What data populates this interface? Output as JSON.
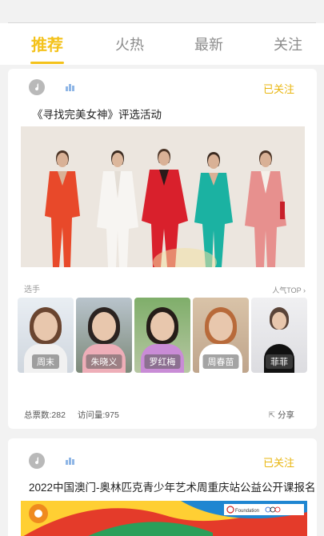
{
  "tabs": [
    {
      "label": "推荐",
      "active": true
    },
    {
      "label": "火热",
      "active": false
    },
    {
      "label": "最新",
      "active": false
    },
    {
      "label": "关注",
      "active": false
    }
  ],
  "accent_color": "#f4c21b",
  "cards": [
    {
      "follow_label": "已关注",
      "title": "《寻找完美女神》评选活动",
      "section_label": "选手",
      "popularity_label": "人气TOP",
      "contestants": [
        "周末",
        "朱晓义",
        "罗红梅",
        "周春苗",
        "菲菲"
      ],
      "stats": {
        "votes": "总票数:282",
        "visits": "访问量:975"
      },
      "share_label": "分享"
    },
    {
      "follow_label": "已关注",
      "title": "2022中国澳门-奥林匹克青少年艺术周重庆站公益公开课报名",
      "banner_logo_text": "Foundation"
    }
  ]
}
